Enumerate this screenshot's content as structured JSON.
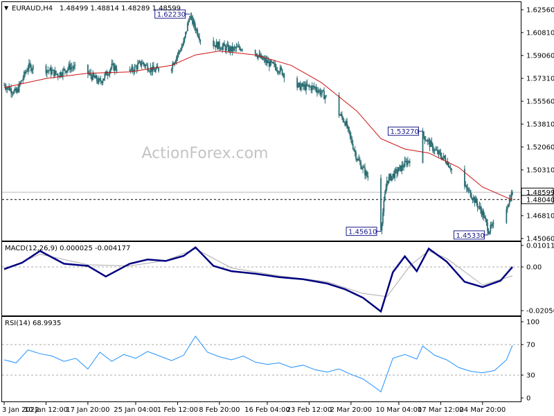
{
  "chart_data": [
    {
      "type": "candlestick",
      "symbol_header": "EURAUD,H4",
      "ohlc_text": "1.48499 1.48814 1.48289 1.48599",
      "watermark": "ActionForex.com",
      "y_ticks": [
        "1.62560",
        "1.60810",
        "1.59060",
        "1.57310",
        "1.55560",
        "1.53810",
        "1.52060",
        "1.50310",
        "1.46810",
        "1.45060"
      ],
      "ylim": [
        1.4506,
        1.6256
      ],
      "current_price_label": "1.48599",
      "current_price": 1.48599,
      "dashed_level_label": "1.48040",
      "dashed_level": 1.4804,
      "annotations": [
        {
          "text": "1.62230",
          "price": 1.6223,
          "date": "2022-02-03"
        },
        {
          "text": "1.45610",
          "price": 1.4561,
          "date": "2022-03-07"
        },
        {
          "text": "1.53270",
          "price": 1.5327,
          "date": "2022-03-14"
        },
        {
          "text": "1.45330",
          "price": 1.4533,
          "date": "2022-03-25"
        }
      ],
      "moving_average": {
        "x": [
          "2022-01-03",
          "2022-01-10",
          "2022-01-17",
          "2022-01-24",
          "2022-01-31",
          "2022-02-04",
          "2022-02-08",
          "2022-02-14",
          "2022-02-20",
          "2022-02-25",
          "2022-03-03",
          "2022-03-07",
          "2022-03-11",
          "2022-03-15",
          "2022-03-20",
          "2022-03-24",
          "2022-03-29"
        ],
        "y": [
          1.566,
          1.573,
          1.577,
          1.578,
          1.583,
          1.591,
          1.594,
          1.591,
          1.583,
          1.57,
          1.548,
          1.527,
          1.519,
          1.516,
          1.505,
          1.49,
          1.48
        ]
      },
      "price_path": {
        "x": [
          "2022-01-03",
          "2022-01-05",
          "2022-01-07",
          "2022-01-10",
          "2022-01-12",
          "2022-01-14",
          "2022-01-17",
          "2022-01-19",
          "2022-01-21",
          "2022-01-24",
          "2022-01-26",
          "2022-01-28",
          "2022-01-31",
          "2022-02-02",
          "2022-02-03",
          "2022-02-05",
          "2022-02-08",
          "2022-02-10",
          "2022-02-13",
          "2022-02-15",
          "2022-02-18",
          "2022-02-21",
          "2022-02-24",
          "2022-02-26",
          "2022-03-01",
          "2022-03-03",
          "2022-03-05",
          "2022-03-07",
          "2022-03-08",
          "2022-03-10",
          "2022-03-12",
          "2022-03-14",
          "2022-03-16",
          "2022-03-18",
          "2022-03-20",
          "2022-03-22",
          "2022-03-24",
          "2022-03-25",
          "2022-03-27",
          "2022-03-29"
        ],
        "y": [
          1.568,
          1.562,
          1.582,
          1.58,
          1.576,
          1.582,
          1.577,
          1.57,
          1.582,
          1.578,
          1.585,
          1.579,
          1.583,
          1.6,
          1.621,
          1.602,
          1.598,
          1.595,
          1.598,
          1.588,
          1.58,
          1.567,
          1.566,
          1.558,
          1.54,
          1.512,
          1.496,
          1.459,
          1.495,
          1.503,
          1.512,
          1.53,
          1.518,
          1.51,
          1.495,
          1.485,
          1.47,
          1.457,
          1.464,
          1.486
        ]
      },
      "x_tick_labels": [
        "3 Jan 2022",
        "10 Jan 12:00",
        "17 Jan 20:00",
        "25 Jan 04:00",
        "1 Feb 12:00",
        "8 Feb 20:00",
        "16 Feb 04:00",
        "23 Feb 12:00",
        "2 Mar 20:00",
        "10 Mar 04:00",
        "17 Mar 12:00",
        "24 Mar 20:00"
      ],
      "x_tick_dates": [
        "2022-01-03",
        "2022-01-10",
        "2022-01-17",
        "2022-01-25",
        "2022-02-01",
        "2022-02-08",
        "2022-02-16",
        "2022-02-23",
        "2022-03-02",
        "2022-03-10",
        "2022-03-17",
        "2022-03-24"
      ],
      "colors": {
        "candles": "#2b6d72",
        "ma": "#cc1111",
        "price_line": "#bbbbbb",
        "annotation_border": "#1a1a8c"
      }
    },
    {
      "type": "line",
      "title": "MACD(12,26,9) 0.000025 -0.004177",
      "y_ticks": [
        "0.010113",
        "0.00",
        "-0.020561"
      ],
      "ylim": [
        -0.020561,
        0.010113
      ],
      "current_value_label": "0.00",
      "series": [
        {
          "color": "#000080",
          "x": [
            "2022-01-03",
            "2022-01-06",
            "2022-01-09",
            "2022-01-13",
            "2022-01-17",
            "2022-01-20",
            "2022-01-24",
            "2022-01-27",
            "2022-01-30",
            "2022-02-02",
            "2022-02-04",
            "2022-02-07",
            "2022-02-10",
            "2022-02-14",
            "2022-02-18",
            "2022-02-22",
            "2022-02-26",
            "2022-03-01",
            "2022-03-04",
            "2022-03-07",
            "2022-03-09",
            "2022-03-11",
            "2022-03-13",
            "2022-03-15",
            "2022-03-18",
            "2022-03-21",
            "2022-03-24",
            "2022-03-27",
            "2022-03-29"
          ],
          "y": [
            -0.001,
            0.002,
            0.0075,
            0.0015,
            0.0005,
            -0.0045,
            0.0015,
            0.0035,
            0.0028,
            0.0052,
            0.0092,
            0.0005,
            -0.002,
            -0.0032,
            -0.0048,
            -0.0058,
            -0.0078,
            -0.0105,
            -0.0145,
            -0.021,
            -0.0025,
            0.005,
            -0.002,
            0.0086,
            0.0025,
            -0.007,
            -0.0095,
            -0.0065,
            0.0
          ]
        },
        {
          "color": "#aaaaaa",
          "x": [
            "2022-01-03",
            "2022-01-09",
            "2022-01-17",
            "2022-01-24",
            "2022-01-30",
            "2022-02-04",
            "2022-02-10",
            "2022-02-18",
            "2022-02-26",
            "2022-03-04",
            "2022-03-08",
            "2022-03-12",
            "2022-03-15",
            "2022-03-18",
            "2022-03-24",
            "2022-03-29"
          ],
          "y": [
            -0.0015,
            0.006,
            0.001,
            0.0005,
            0.003,
            0.0085,
            -0.0005,
            -0.0042,
            -0.007,
            -0.0125,
            -0.014,
            0.001,
            0.0075,
            0.004,
            -0.0085,
            -0.0042
          ]
        }
      ]
    },
    {
      "type": "line",
      "title": "RSI(14) 68.9935",
      "y_ticks": [
        "100",
        "70",
        "30",
        "0"
      ],
      "ylim": [
        0,
        100
      ],
      "levels": [
        70,
        30
      ],
      "series": [
        {
          "color": "#1e90ff",
          "x": [
            "2022-01-03",
            "2022-01-05",
            "2022-01-07",
            "2022-01-09",
            "2022-01-11",
            "2022-01-13",
            "2022-01-15",
            "2022-01-17",
            "2022-01-19",
            "2022-01-21",
            "2022-01-23",
            "2022-01-25",
            "2022-01-27",
            "2022-01-29",
            "2022-01-31",
            "2022-02-02",
            "2022-02-04",
            "2022-02-06",
            "2022-02-08",
            "2022-02-10",
            "2022-02-12",
            "2022-02-14",
            "2022-02-16",
            "2022-02-18",
            "2022-02-20",
            "2022-02-22",
            "2022-02-24",
            "2022-02-26",
            "2022-02-28",
            "2022-03-02",
            "2022-03-04",
            "2022-03-06",
            "2022-03-07",
            "2022-03-09",
            "2022-03-11",
            "2022-03-13",
            "2022-03-14",
            "2022-03-16",
            "2022-03-18",
            "2022-03-20",
            "2022-03-22",
            "2022-03-24",
            "2022-03-26",
            "2022-03-28",
            "2022-03-29"
          ],
          "y": [
            50,
            46,
            63,
            58,
            55,
            48,
            52,
            38,
            60,
            48,
            57,
            52,
            61,
            55,
            49,
            56,
            81,
            60,
            54,
            50,
            55,
            47,
            44,
            46,
            40,
            43,
            37,
            34,
            38,
            31,
            25,
            14,
            8,
            52,
            57,
            51,
            68,
            56,
            50,
            40,
            35,
            33,
            36,
            50,
            69
          ]
        }
      ]
    }
  ]
}
